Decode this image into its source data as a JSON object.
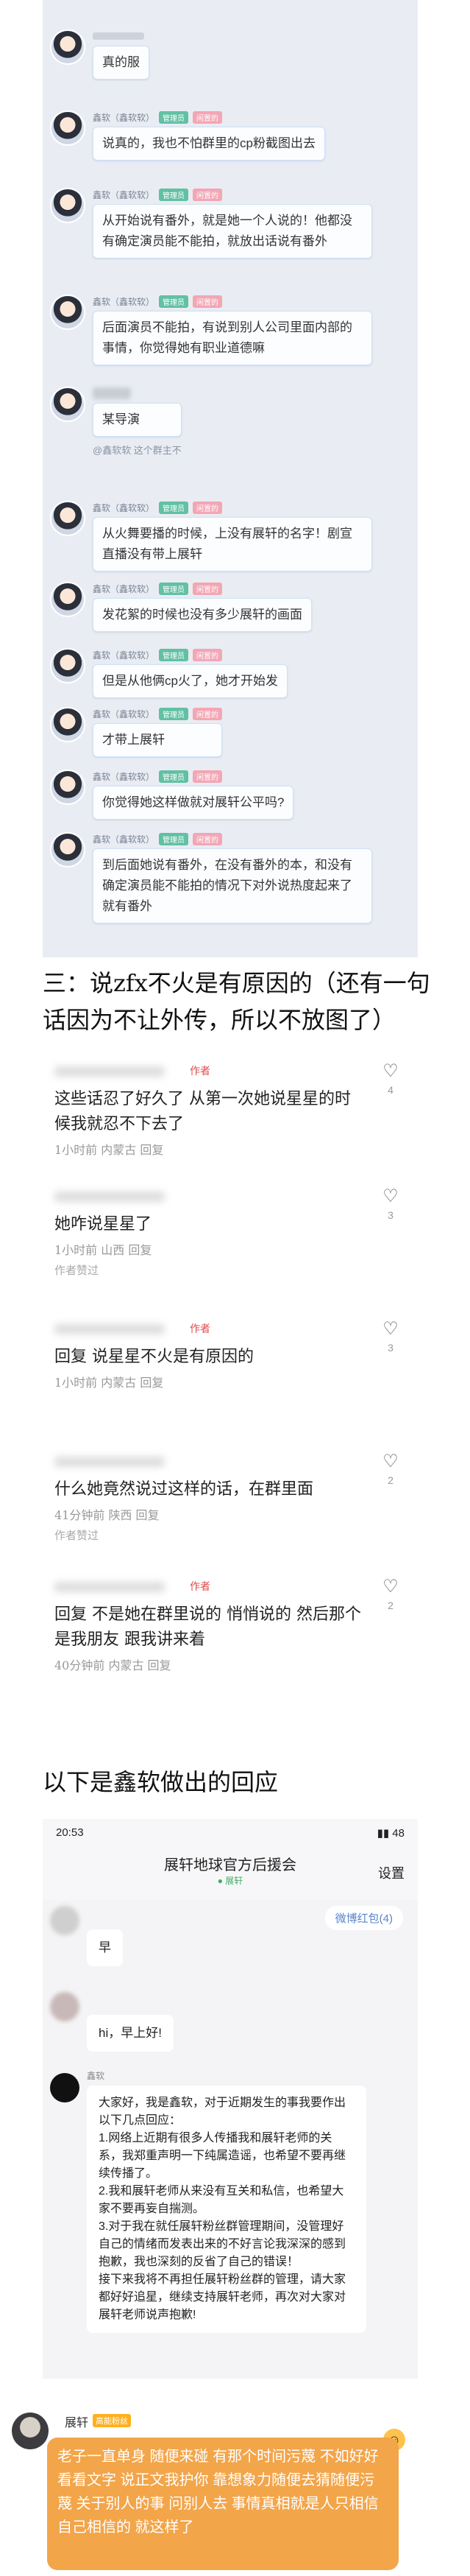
{
  "chat1": {
    "top_reply": "真的服",
    "messages": [
      {
        "name": "鑫软（鑫软软）",
        "badge1": "管理员",
        "badge2": "闲置的",
        "text": "说真的，我也不怕群里的cp粉截图出去"
      },
      {
        "name": "鑫软（鑫软软）",
        "badge1": "管理员",
        "badge2": "闲置的",
        "text": "从开始说有番外，就是她一个人说的！他都没有确定演员能不能拍，就放出话说有番外"
      },
      {
        "name": "鑫软（鑫软软）",
        "badge1": "管理员",
        "badge2": "闲置的",
        "text": "后面演员不能拍，有说到别人公司里面内部的事情，你觉得她有职业道德嘛"
      },
      {
        "name": "",
        "badge1": "",
        "badge2": "",
        "text": "某导演",
        "quote": "@鑫软软 这个群主不"
      },
      {
        "name": "鑫软（鑫软软）",
        "badge1": "管理员",
        "badge2": "闲置的",
        "text": "从火舞要播的时候，上没有展轩的名字！剧宣直播没有带上展轩"
      },
      {
        "name": "鑫软（鑫软软）",
        "badge1": "管理员",
        "badge2": "闲置的",
        "text": "发花絮的时候也没有多少展轩的画面"
      },
      {
        "name": "鑫软（鑫软软）",
        "badge1": "管理员",
        "badge2": "闲置的",
        "text": "但是从他俩cp火了，她才开始发"
      },
      {
        "name": "鑫软（鑫软软）",
        "badge1": "管理员",
        "badge2": "闲置的",
        "text": "才带上展轩"
      },
      {
        "name": "鑫软（鑫软软）",
        "badge1": "管理员",
        "badge2": "闲置的",
        "text": "你觉得她这样做就对展轩公平吗?"
      },
      {
        "name": "鑫软（鑫软软）",
        "badge1": "管理员",
        "badge2": "闲置的",
        "text": "到后面她说有番外，在没有番外的本，和没有确定演员能不能拍的情况下对外说热度起来了就有番外"
      }
    ]
  },
  "heading2": "三：说zfx不火是有原因的（还有一句话因为不让外传，所以不放图了）",
  "comments": {
    "items": [
      {
        "tag": "作者",
        "text": "这些话忍了好久了 从第一次她说星星的时候我就忍不下去了",
        "meta": "1小时前 内蒙古 回复",
        "likes": "4"
      },
      {
        "tag": "",
        "text": "她咋说星星了",
        "meta": "1小时前 山西 回复",
        "sub": "作者赞过",
        "likes": "3"
      },
      {
        "tag": "作者",
        "text": "回复 说星星不火是有原因的 ",
        "meta": "1小时前 内蒙古 回复",
        "likes": "3"
      },
      {
        "tag": "",
        "text": "什么她竟然说过这样的话，在群里面",
        "meta": "41分钟前 陕西 回复",
        "sub": "作者赞过",
        "likes": "2"
      },
      {
        "tag": "作者",
        "text": "回复 不是她在群里说的 悄悄说的 然后那个是我朋友 跟我讲来着",
        "meta": "40分钟前 内蒙古 回复",
        "likes": "2"
      }
    ]
  },
  "heading3": "以下是鑫软做出的回应",
  "phone": {
    "time": "20:53",
    "status_right": "▮▮ 48",
    "title": "展轩地球官方后援会",
    "subtitle": "● 展轩",
    "settings": "设置",
    "redpack": "微博红包(4)",
    "msg_early": "早",
    "msg_hi": "hi，早上好!",
    "sender": "鑫软",
    "statement": "大家好，我是鑫软，对于近期发生的事我要作出以下几点回应：\n1.网络上近期有很多人传播我和展轩老师的关系，我郑重声明一下纯属造谣，也希望不要再继续传播了。\n2.我和展轩老师从来没有互关和私信，也希望大家不要再妄自揣测。\n3.对于我在就任展轩粉丝群管理期间，没管理好自己的情绪而发表出来的不好言论我深深的感到抱歉，我也深刻的反省了自己的错误！\n接下来我将不再担任展轩粉丝群的管理，请大家都好好追星，继续支持展轩老师，再次对大家对展轩老师说声抱歉!"
  },
  "danmaku": {
    "name": "展轩",
    "level": "高能粉丝",
    "text": "老子一直单身 随便来碰 有那个时间污蔑 不如好好看看文字 说正文我护你 靠想象力随便去猜随便污蔑 关于别人的事 问别人去 事情真相就是人只相信自己相信的 就这样了"
  },
  "colors": {
    "chat_bg": "#e9edf3",
    "bubble_border": "#cfe1f7",
    "author_red": "#e24a4a",
    "danmaku_orange": "#f3a54a"
  }
}
